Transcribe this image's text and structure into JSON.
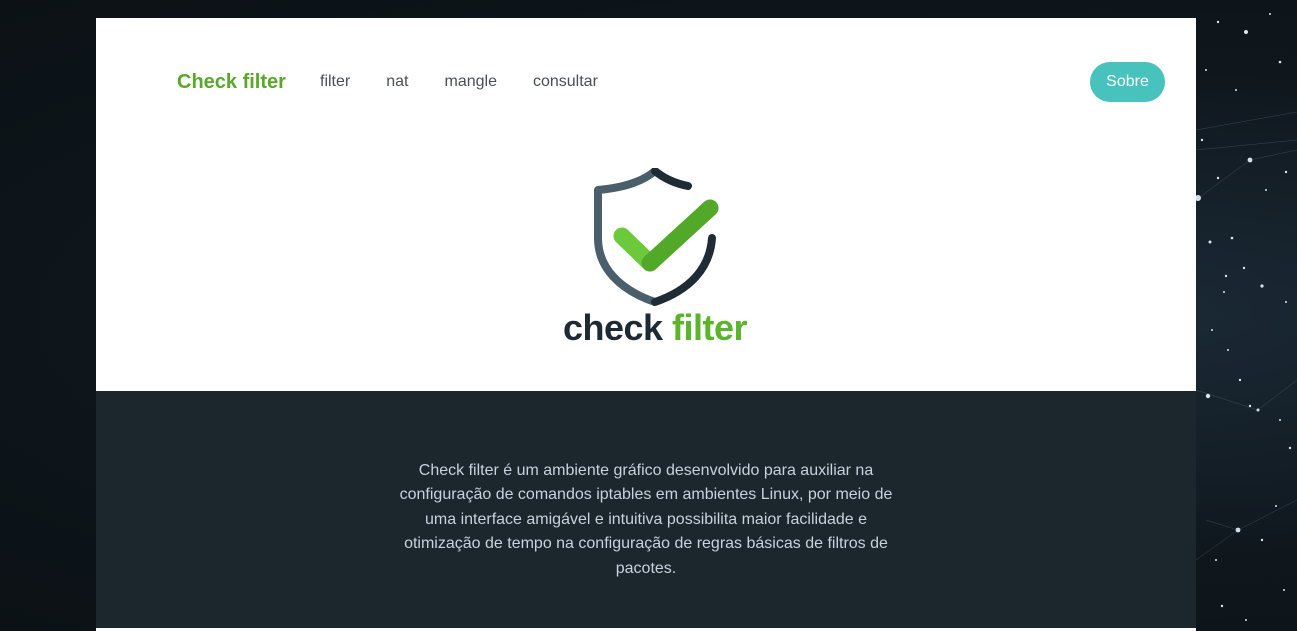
{
  "navbar": {
    "brand": "Check filter",
    "links": [
      "filter",
      "nat",
      "mangle",
      "consultar"
    ],
    "about_button": "Sobre"
  },
  "logo": {
    "word1": "check",
    "word2": "filter",
    "icon": "shield-check-icon",
    "colors": {
      "dark": "#1e2a33",
      "green": "#5ab52a",
      "shield": "#4a5e6b"
    }
  },
  "about": {
    "text": "Check filter é um ambiente gráfico desenvolvido para auxiliar na configuração de comandos iptables em ambientes Linux, por meio de uma interface amigável e intuitiva possibilita maior facilidade e otimização de tempo na configuração de regras básicas de filtros de pacotes."
  },
  "colors": {
    "brand_green": "#5aa82b",
    "button_teal": "#47c2bd",
    "dark_section": "#1b262d",
    "about_text": "#c8d1dc"
  }
}
